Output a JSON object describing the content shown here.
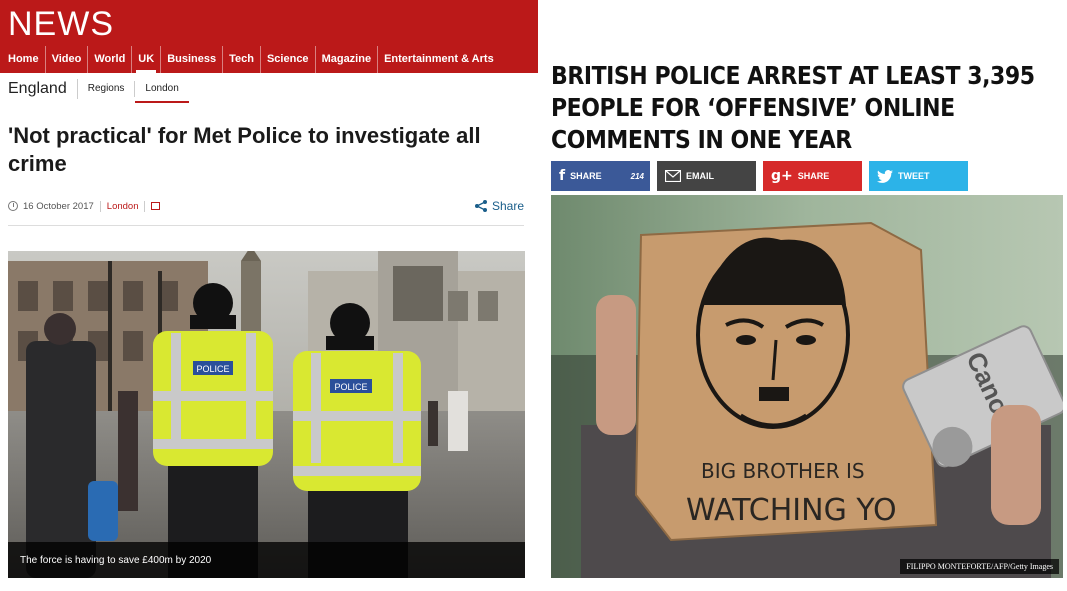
{
  "left_page": {
    "brand": "NEWS",
    "nav": [
      "Home",
      "Video",
      "World",
      "UK",
      "Business",
      "Tech",
      "Science",
      "Magazine",
      "Entertainment & Arts"
    ],
    "nav_active": "UK",
    "section_title": "England",
    "subnav": [
      "Regions",
      "London"
    ],
    "subnav_active": "London",
    "headline": "'Not practical' for Met Police to investigate all crime",
    "date": "16 October 2017",
    "section": "London",
    "share_label": "Share",
    "photo_caption": "The force is having to save £400m by 2020",
    "photo_text": [
      "POLICE",
      "POLICE"
    ],
    "accent_color": "#bb1919"
  },
  "right_page": {
    "headline": "BRITISH POLICE ARREST AT LEAST 3,395 PEOPLE FOR ‘OFFENSIVE’ ONLINE COMMENTS IN ONE YEAR",
    "share_buttons": [
      {
        "icon": "facebook-icon",
        "label": "SHARE",
        "count": "214",
        "color": "#3b5998"
      },
      {
        "icon": "email-icon",
        "label": "EMAIL",
        "color": "#444444"
      },
      {
        "icon": "google-plus-icon",
        "label": "SHARE",
        "color": "#d62a2a"
      },
      {
        "icon": "twitter-icon",
        "label": "TWEET",
        "color": "#2cb3e8"
      }
    ],
    "photo_sign_text": [
      "BIG BROTHER IS",
      "WATCHING YO"
    ],
    "photo_camera_text": "Canon",
    "photo_credit": "FILIPPO MONTEFORTE/AFP/Getty Images"
  }
}
